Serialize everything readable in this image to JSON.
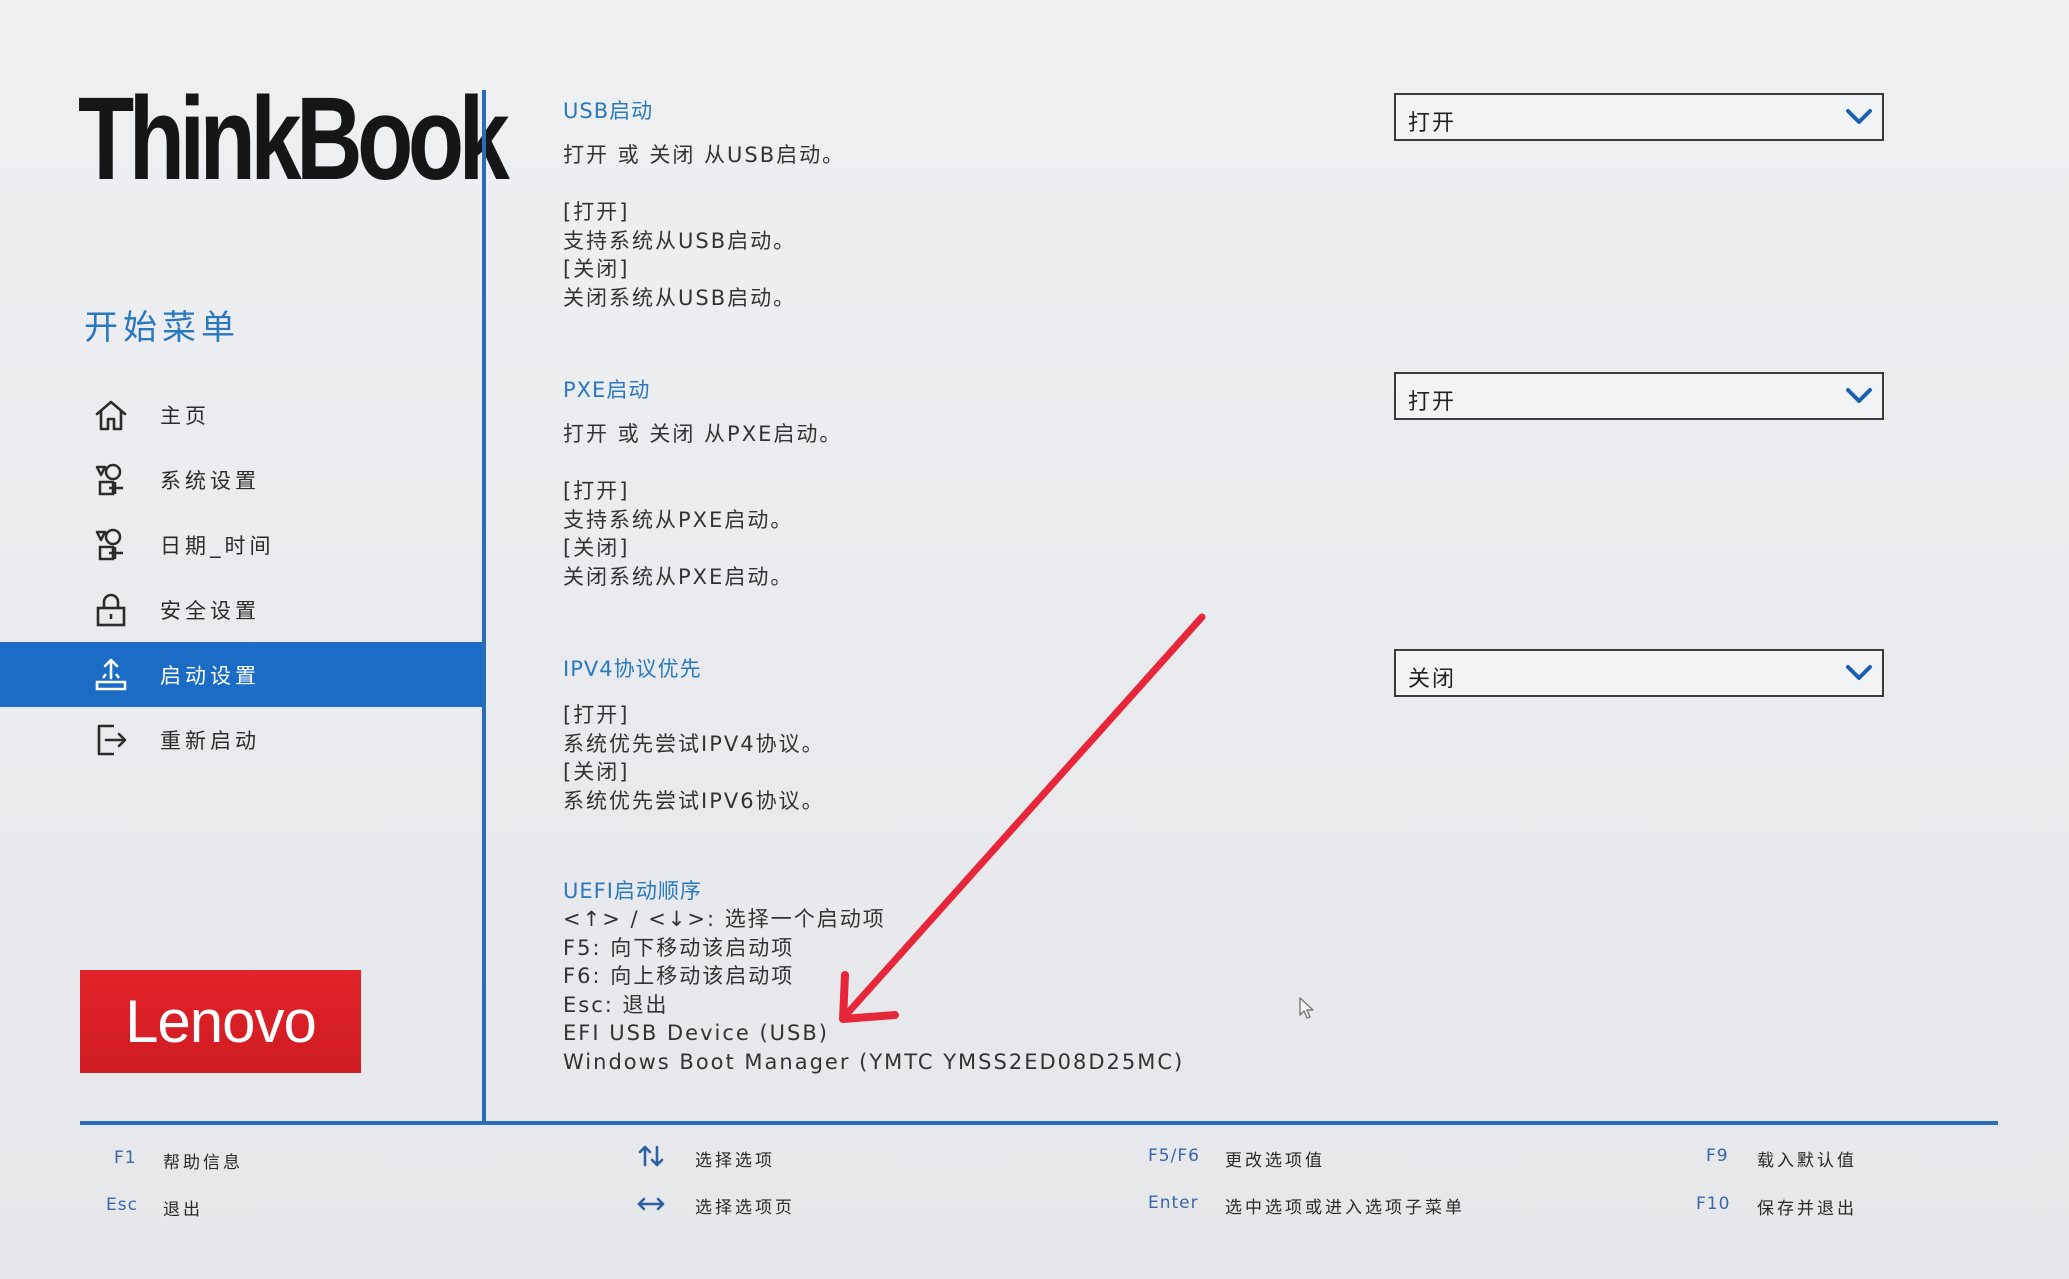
{
  "brand": "ThinkBook",
  "sidebar": {
    "title": "开始菜单",
    "items": [
      {
        "label": "主页",
        "icon": "home-icon",
        "active": false
      },
      {
        "label": "系统设置",
        "icon": "shapes-icon",
        "active": false
      },
      {
        "label": "日期_时间",
        "icon": "shapes-icon",
        "active": false
      },
      {
        "label": "安全设置",
        "icon": "lock-icon",
        "active": false
      },
      {
        "label": "启动设置",
        "icon": "boot-icon",
        "active": true
      },
      {
        "label": "重新启动",
        "icon": "exit-icon",
        "active": false
      }
    ],
    "logo": "Lenovo"
  },
  "colors": {
    "accent": "#1a6cc4",
    "title_blue": "#2a78be",
    "logo_red": "#e01f26",
    "annotation_red": "#e8263a"
  },
  "settings": {
    "usb": {
      "title": "USB启动",
      "desc": "打开 或 关闭 从USB启动。\n\n[打开]\n支持系统从USB启动。\n[关闭]\n关闭系统从USB启动。",
      "value": "打开"
    },
    "pxe": {
      "title": "PXE启动",
      "desc": "打开 或 关闭 从PXE启动。\n\n[打开]\n支持系统从PXE启动。\n[关闭]\n关闭系统从PXE启动。",
      "value": "打开"
    },
    "ipv4": {
      "title": "IPV4协议优先",
      "desc": "[打开]\n系统优先尝试IPV4协议。\n[关闭]\n系统优先尝试IPV6协议。",
      "value": "关闭"
    },
    "uefi": {
      "title": "UEFI启动顺序",
      "desc": "<↑> / <↓>: 选择一个启动项\nF5: 向下移动该启动项\nF6: 向上移动该启动项\nEsc: 退出\nEFI USB Device (USB)\nWindows Boot Manager (YMTC YMSS2ED08D25MC)"
    }
  },
  "footer": {
    "f1_key": "F1",
    "f1_desc": "帮助信息",
    "esc_key": "Esc",
    "esc_desc": "退出",
    "updown_desc": "选择选项",
    "leftright_desc": "选择选项页",
    "f5f6_key": "F5/F6",
    "f5f6_desc": "更改选项值",
    "enter_key": "Enter",
    "enter_desc": "选中选项或进入选项子菜单",
    "f9_key": "F9",
    "f9_desc": "载入默认值",
    "f10_key": "F10",
    "f10_desc": "保存并退出"
  }
}
